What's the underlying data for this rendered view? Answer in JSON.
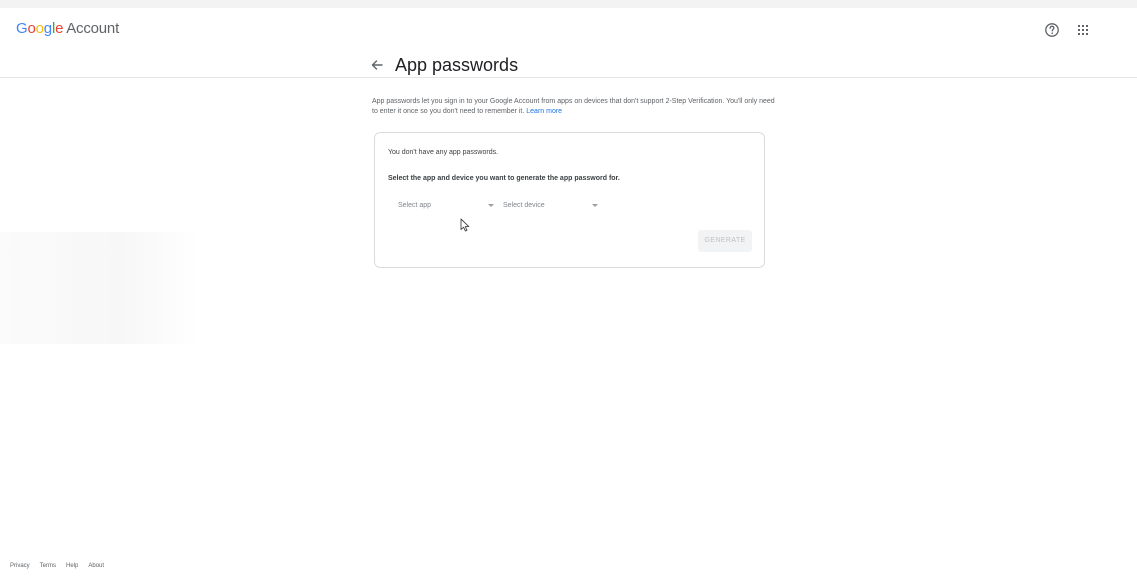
{
  "header": {
    "brand_letters": [
      "G",
      "o",
      "o",
      "g",
      "l",
      "e"
    ],
    "account_label": "Account",
    "help_icon": "help-circle-icon",
    "apps_icon": "apps-grid-icon"
  },
  "page": {
    "back_icon": "arrow-left-icon",
    "title": "App passwords",
    "description": "App passwords let you sign in to your Google Account from apps on devices that don't support 2-Step Verification. You'll only need to enter it once so you don't need to remember it.",
    "learn_more": "Learn more"
  },
  "card": {
    "no_passwords_text": "You don't have any app passwords.",
    "instruction": "Select the app and device you want to generate the app password for.",
    "select_app": {
      "value": "Select app"
    },
    "select_device": {
      "value": "Select device"
    },
    "generate_label": "GENERATE"
  },
  "footer": {
    "links": [
      "Privacy",
      "Terms",
      "Help",
      "About"
    ]
  },
  "colors": {
    "google_blue": "#4285f4",
    "google_red": "#ea4335",
    "google_yellow": "#fbbc05",
    "google_green": "#34a853",
    "link_blue": "#1a73e8",
    "disabled_button_bg": "#f1f3f4",
    "disabled_button_text": "#bdc1c6"
  }
}
